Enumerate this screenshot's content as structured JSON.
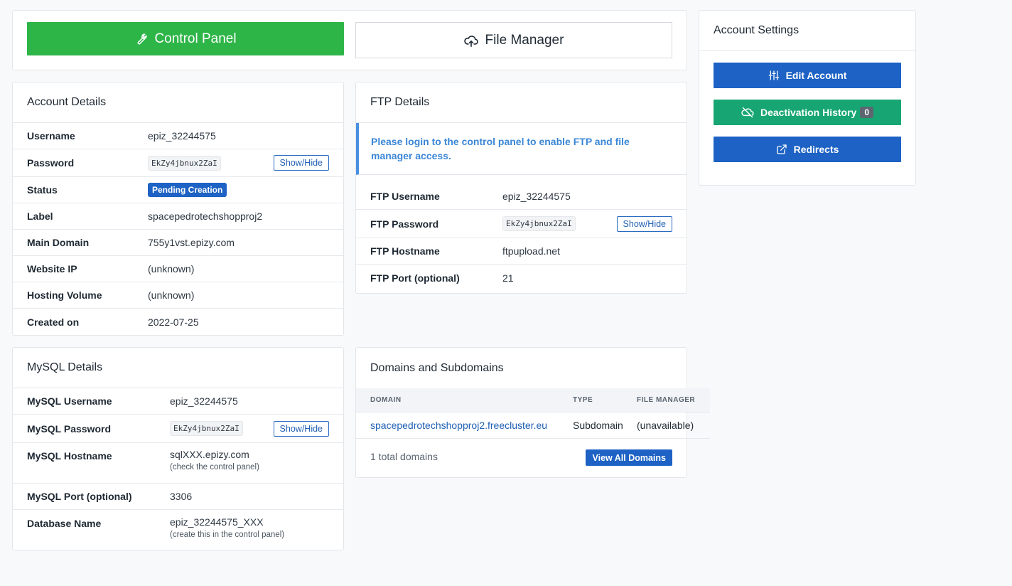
{
  "top": {
    "control_panel_label": "Control Panel",
    "file_manager_label": "File Manager"
  },
  "account_details": {
    "title": "Account Details",
    "rows": {
      "username": {
        "label": "Username",
        "value": "epiz_32244575"
      },
      "password": {
        "label": "Password",
        "value": "EkZy4jbnux2ZaI"
      },
      "status": {
        "label": "Status",
        "value": "Pending Creation"
      },
      "label": {
        "label": "Label",
        "value": "spacepedrotechshopproj2"
      },
      "main_domain": {
        "label": "Main Domain",
        "value": "755y1vst.epizy.com"
      },
      "website_ip": {
        "label": "Website IP",
        "value": "(unknown)"
      },
      "hosting_volume": {
        "label": "Hosting Volume",
        "value": "(unknown)"
      },
      "created_on": {
        "label": "Created on",
        "value": "2022-07-25"
      }
    },
    "show_hide_label": "Show/Hide"
  },
  "ftp_details": {
    "title": "FTP Details",
    "alert": "Please login to the control panel to enable FTP and file manager access.",
    "rows": {
      "username": {
        "label": "FTP Username",
        "value": "epiz_32244575"
      },
      "password": {
        "label": "FTP Password",
        "value": "EkZy4jbnux2ZaI"
      },
      "hostname": {
        "label": "FTP Hostname",
        "value": "ftpupload.net"
      },
      "port": {
        "label": "FTP Port (optional)",
        "value": "21"
      }
    },
    "show_hide_label": "Show/Hide"
  },
  "account_settings": {
    "title": "Account Settings",
    "edit_account": "Edit Account",
    "deactivation_history": "Deactivation History",
    "deactivation_count": "0",
    "redirects": "Redirects",
    "colors": {
      "blue": "#1d62c4",
      "green": "#17a673"
    }
  },
  "mysql_details": {
    "title": "MySQL Details",
    "rows": {
      "username": {
        "label": "MySQL Username",
        "value": "epiz_32244575"
      },
      "password": {
        "label": "MySQL Password",
        "value": "EkZy4jbnux2ZaI"
      },
      "hostname": {
        "label": "MySQL Hostname",
        "value": "sqlXXX.epizy.com",
        "note": "(check the control panel)"
      },
      "port": {
        "label": "MySQL Port (optional)",
        "value": "3306"
      },
      "database": {
        "label": "Database Name",
        "value": "epiz_32244575_XXX",
        "note": "(create this in the control panel)"
      }
    },
    "show_hide_label": "Show/Hide"
  },
  "domains": {
    "title": "Domains and Subdomains",
    "columns": [
      "DOMAIN",
      "TYPE",
      "FILE MANAGER"
    ],
    "rows": [
      {
        "domain": "spacepedrotechshopproj2.freecluster.eu",
        "type": "Subdomain",
        "file_manager": "(unavailable)"
      }
    ],
    "total": "1 total domains",
    "view_all": "View All Domains"
  }
}
